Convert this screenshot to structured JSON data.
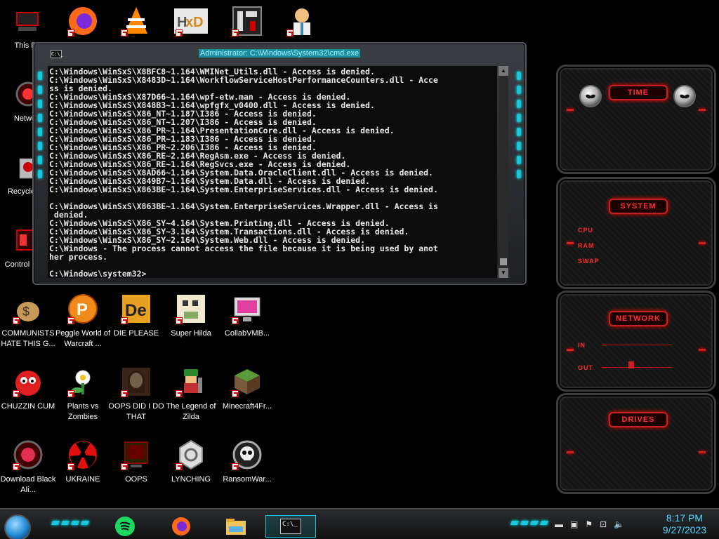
{
  "desktop_icons": [
    {
      "id": "this-pc",
      "label": "This PC",
      "col": 0,
      "row": 0
    },
    {
      "id": "firefox",
      "label": "",
      "col": 1,
      "row": 0
    },
    {
      "id": "vlc",
      "label": "",
      "col": 2,
      "row": 0
    },
    {
      "id": "hxd",
      "label": "",
      "col": 3,
      "row": 0
    },
    {
      "id": "app5",
      "label": "",
      "col": 4,
      "row": 0
    },
    {
      "id": "doctor",
      "label": "",
      "col": 5,
      "row": 0
    },
    {
      "id": "network",
      "label": "Network",
      "col": 0,
      "row": 1
    },
    {
      "id": "recycle",
      "label": "Recycle Bin",
      "col": 0,
      "row": 2
    },
    {
      "id": "control",
      "label": "Control Panel",
      "col": 0,
      "row": 3
    },
    {
      "id": "communists",
      "label": "COMMUNISTS HATE THIS G...",
      "col": 0,
      "row": 4
    },
    {
      "id": "peggle",
      "label": "Peggle World of Warcraft ...",
      "col": 1,
      "row": 4
    },
    {
      "id": "die-please",
      "label": "DIE PLEASE",
      "col": 2,
      "row": 4
    },
    {
      "id": "super-hilda",
      "label": "Super Hilda",
      "col": 3,
      "row": 4
    },
    {
      "id": "collabvm",
      "label": "CollabVMB...",
      "col": 4,
      "row": 4
    },
    {
      "id": "chuzzin",
      "label": "CHUZZIN CUM",
      "col": 0,
      "row": 5
    },
    {
      "id": "pvz",
      "label": "Plants vs Zombies",
      "col": 1,
      "row": 5
    },
    {
      "id": "oops-did",
      "label": "OOPS DID I DO THAT",
      "col": 2,
      "row": 5
    },
    {
      "id": "zilda",
      "label": "The Legend of Zilda",
      "col": 3,
      "row": 5
    },
    {
      "id": "minecraft",
      "label": "Minecraft4Fr...",
      "col": 4,
      "row": 5
    },
    {
      "id": "blackali",
      "label": "Download Black Ali...",
      "col": 0,
      "row": 6
    },
    {
      "id": "ukraine",
      "label": "UKRAINE",
      "col": 1,
      "row": 6
    },
    {
      "id": "oops",
      "label": "OOPS",
      "col": 2,
      "row": 6
    },
    {
      "id": "lynching",
      "label": "LYNCHING",
      "col": 3,
      "row": 6
    },
    {
      "id": "ransomware",
      "label": "RansomWar...",
      "col": 4,
      "row": 6
    }
  ],
  "cmd": {
    "title": "Administrator: C:\\Windows\\System32\\cmd.exe",
    "icon_text": "C:\\_",
    "lines": [
      "C:\\Windows\\WinSxS\\X8BFC8~1.164\\WMINet_Utils.dll - Access is denied.",
      "C:\\Windows\\WinSxS\\X8483D~1.164\\WorkflowServiceHostPerformanceCounters.dll - Acce",
      "ss is denied.",
      "C:\\Windows\\WinSxS\\X87D66~1.164\\wpf-etw.man - Access is denied.",
      "C:\\Windows\\WinSxS\\X848B3~1.164\\wpfgfx_v0400.dll - Access is denied.",
      "C:\\Windows\\WinSxS\\X86_NT~1.187\\I386 - Access is denied.",
      "C:\\Windows\\WinSxS\\X86_NT~1.207\\I386 - Access is denied.",
      "C:\\Windows\\WinSxS\\X86_PR~1.164\\PresentationCore.dll - Access is denied.",
      "C:\\Windows\\WinSxS\\X86_PR~1.183\\I386 - Access is denied.",
      "C:\\Windows\\WinSxS\\X86_PR~2.206\\I386 - Access is denied.",
      "C:\\Windows\\WinSxS\\X86_RE~2.164\\RegAsm.exe - Access is denied.",
      "C:\\Windows\\WinSxS\\X86_RE~1.164\\RegSvcs.exe - Access is denied.",
      "C:\\Windows\\WinSxS\\X8AD66~1.164\\System.Data.OracleClient.dll - Access is denied.",
      "C:\\Windows\\WinSxS\\X849B7~1.164\\System.Data.dll - Access is denied.",
      "C:\\Windows\\WinSxS\\X863BE~1.164\\System.EnterpriseServices.dll - Access is denied.",
      "",
      "C:\\Windows\\WinSxS\\X863BE~1.164\\System.EnterpriseServices.Wrapper.dll - Access is",
      " denied.",
      "C:\\Windows\\WinSxS\\X86_SY~4.164\\System.Printing.dll - Access is denied.",
      "C:\\Windows\\WinSxS\\X86_SY~3.164\\System.Transactions.dll - Access is denied.",
      "C:\\Windows\\WinSxS\\X86_SY~2.164\\System.Web.dll - Access is denied.",
      "C:\\Windows - The process cannot access the file because it is being used by anot",
      "her process.",
      "",
      "C:\\Windows\\system32>"
    ]
  },
  "gadgets": {
    "time": {
      "title": "TIME"
    },
    "system": {
      "title": "SYSTEM",
      "cpu": "CPU",
      "ram": "RAM",
      "swap": "SWAP"
    },
    "network": {
      "title": "NETWORK",
      "in": "IN",
      "out": "OUT"
    },
    "drives": {
      "title": "DRIVES"
    }
  },
  "taskbar": {
    "time": "8:17 PM",
    "date": "9/27/2023",
    "apps": [
      "spotify",
      "firefox",
      "file-explorer",
      "cmd"
    ]
  },
  "colors": {
    "accent_cyan": "#18c6de",
    "accent_red": "#ff2a2a",
    "clock": "#4fd8ff"
  }
}
